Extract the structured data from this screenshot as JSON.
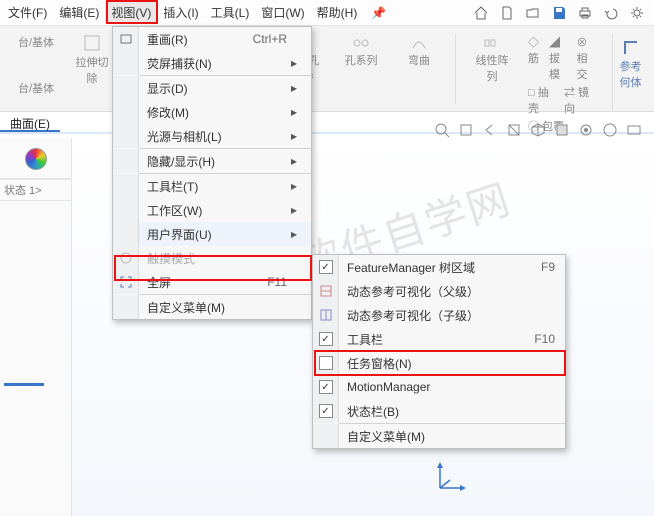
{
  "menubar": {
    "file": "文件(F)",
    "edit": "编辑(E)",
    "view": "视图(V)",
    "insert": "插入(I)",
    "tools": "工具(L)",
    "window": "窗口(W)",
    "help": "帮助(H)"
  },
  "ribbon": {
    "col1a": "台/基体",
    "col1b": "台/基体",
    "col2a": "拉伸切",
    "col2b": "除",
    "g_holewiz_a": "异型孔",
    "g_holewiz_b": "向导",
    "g_holeseries": "孔系列",
    "g_curve": "弯曲",
    "g_linpat_a": "线性阵",
    "g_linpat_b": "列",
    "g_draft": "拔模",
    "g_intersect": "相交",
    "g_shell": "抽壳",
    "g_mirror": "镜向",
    "g_wrap": "包覆",
    "g_rib": "筋",
    "ref_a": "参考",
    "ref_b": "何体"
  },
  "tab": {
    "surface": "曲面(E)"
  },
  "side": {
    "state": "状态 1>"
  },
  "view_menu": {
    "redraw": "重画(R)",
    "redraw_sc": "Ctrl+R",
    "screencap": "荧屏捕获(N)",
    "display": "显示(D)",
    "modify": "修改(M)",
    "lightscam": "光源与相机(L)",
    "hideshow": "隐藏/显示(H)",
    "toolbars": "工具栏(T)",
    "workspace": "工作区(W)",
    "ui": "用户界面(U)",
    "touch": "触摸模式",
    "fullscreen": "全屏",
    "fullscreen_sc": "F11",
    "custom": "自定义菜单(M)"
  },
  "ui_menu": {
    "fm_tree": "FeatureManager 树区域",
    "fm_tree_sc": "F9",
    "dyn_parent": "动态参考可视化（父级）",
    "dyn_child": "动态参考可视化（子级）",
    "toolbar": "工具栏",
    "toolbar_sc": "F10",
    "taskpane": "任务窗格(N)",
    "motionmgr": "MotionManager",
    "statusbar": "状态栏(B)",
    "custom": "自定义菜单(M)"
  },
  "watermark": "软件自学网"
}
